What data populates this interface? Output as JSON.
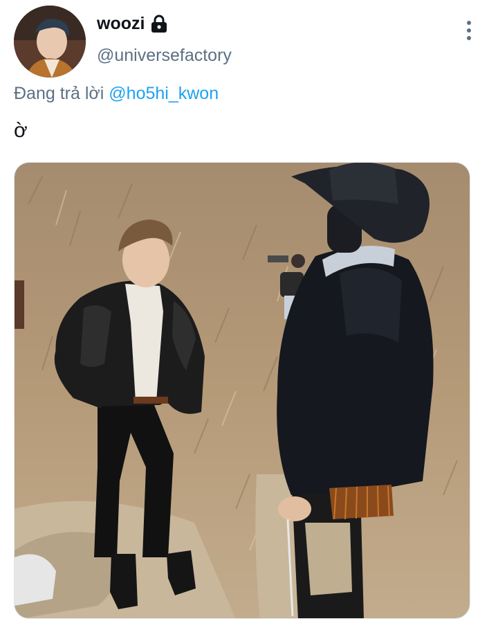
{
  "tweet": {
    "display_name": "woozi",
    "handle": "@universefactory",
    "protected_icon": "lock-icon",
    "reply_prefix": "Đang trả lời",
    "reply_mention": "@ho5hi_kwon",
    "text": "ờ",
    "more_icon": "more-vertical-icon",
    "media_icon": "photo"
  },
  "colors": {
    "text_primary": "#0f1419",
    "text_secondary": "#5b7083",
    "link": "#1da1f2"
  }
}
